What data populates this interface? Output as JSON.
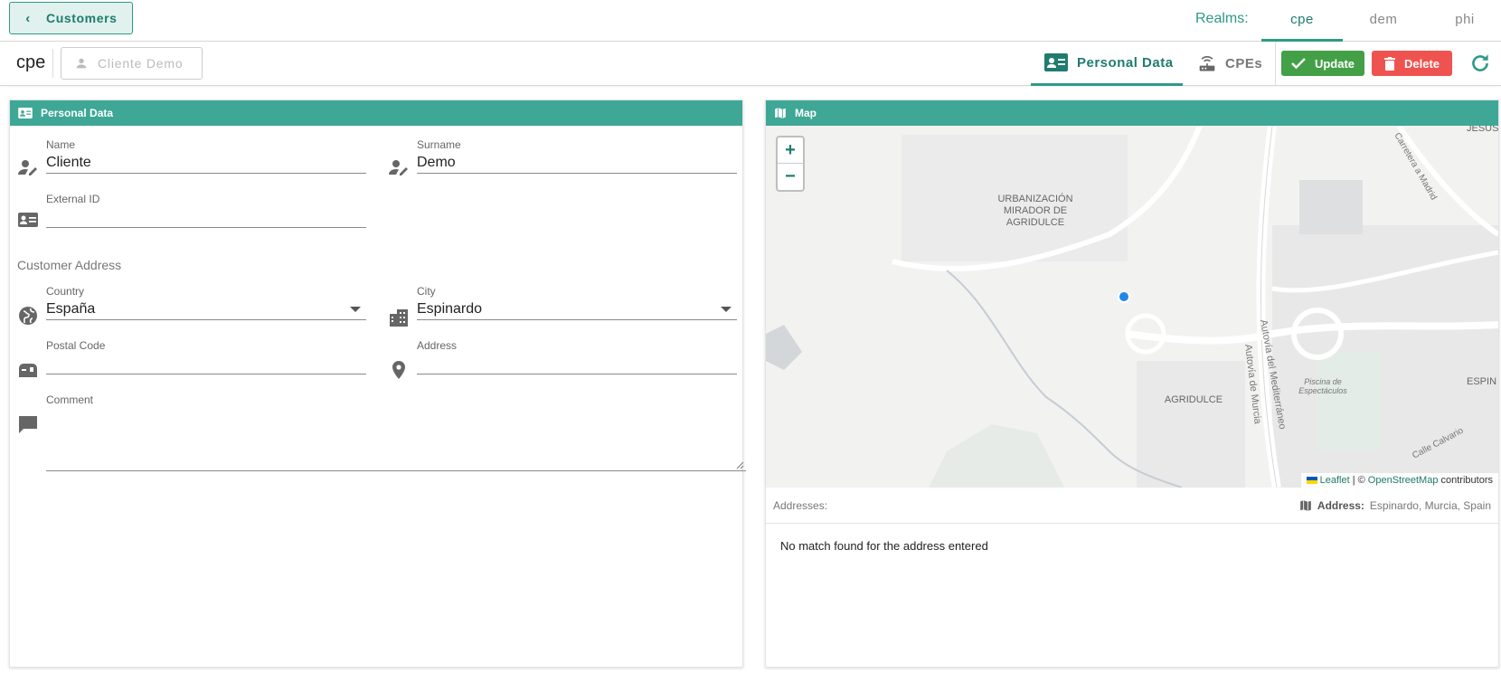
{
  "topbar": {
    "back_label": "Customers",
    "realms_label": "Realms:",
    "realms": [
      "cpe",
      "dem",
      "phi"
    ],
    "active_realm": "cpe"
  },
  "subbar": {
    "realm": "cpe",
    "customer_name": "Cliente Demo",
    "tabs": [
      {
        "label": "Personal Data",
        "icon": "id-card-icon"
      },
      {
        "label": "CPEs",
        "icon": "router-icon"
      }
    ],
    "update_label": "Update",
    "delete_label": "Delete"
  },
  "personal": {
    "header": "Personal Data",
    "name_label": "Name",
    "name_value": "Cliente",
    "surname_label": "Surname",
    "surname_value": "Demo",
    "external_id_label": "External ID",
    "external_id_value": "",
    "address_section": "Customer Address",
    "country_label": "Country",
    "country_value": "España",
    "city_label": "City",
    "city_value": "Espinardo",
    "postal_label": "Postal Code",
    "postal_value": "",
    "address_label": "Address",
    "address_value": "",
    "comment_label": "Comment",
    "comment_value": ""
  },
  "map": {
    "header": "Map",
    "zoom_in": "+",
    "zoom_out": "−",
    "labels": [
      "URBANIZACIÓN",
      "MIRADOR DE",
      "AGRIDULCE",
      "AGRIDULCE",
      "Autovía del Mediterráneo",
      "Autovía de Murcia",
      "Piscina de",
      "Espectáculos",
      "JESÚS",
      "ESPIN",
      "Carretera a Madrid",
      "Calle Calvario"
    ],
    "attribution_leaflet": "Leaflet",
    "attribution_sep": "| ©",
    "attribution_osm": "OpenStreetMap",
    "attribution_contrib": "contributors",
    "addresses_label": "Addresses:",
    "address_key": "Address:",
    "address_value": "Espinardo, Murcia, Spain",
    "no_match": "No match found for the address entered"
  },
  "colors": {
    "accent": "#3ea796",
    "accent_dark": "#1f7c6e",
    "update": "#43a047",
    "delete": "#ef5350"
  }
}
